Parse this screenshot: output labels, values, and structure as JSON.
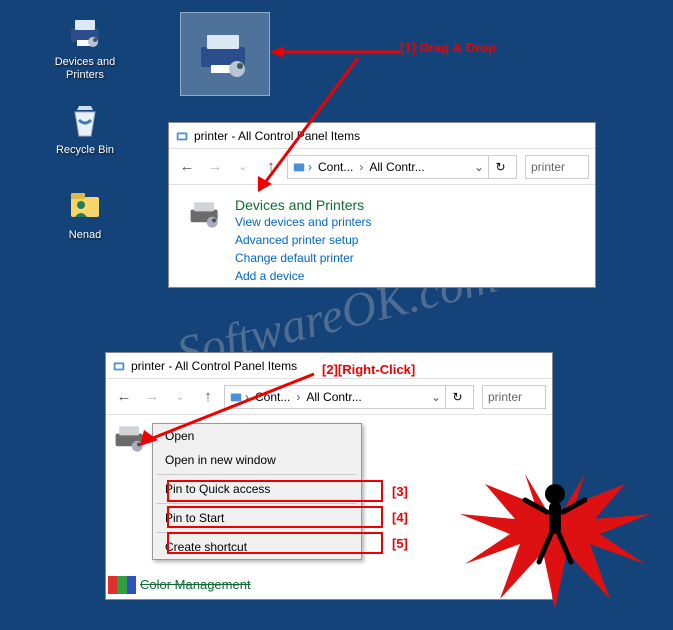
{
  "desktop": {
    "icons": [
      {
        "label": "Devices and\nPrinters",
        "name": "devices-printers-icon"
      },
      {
        "label": "Recycle Bin",
        "name": "recycle-bin-icon"
      },
      {
        "label": "Nenad",
        "name": "user-folder-icon"
      }
    ]
  },
  "annotations": {
    "a1": "[1]  Drag & Drop",
    "a2": "[2][Right-Click]",
    "a3": "[3]",
    "a4": "[4]",
    "a5": "[5]"
  },
  "window1": {
    "title": "printer - All Control Panel Items",
    "addr": {
      "seg1": "Cont...",
      "seg2": "All Contr..."
    },
    "search": "printer",
    "result": {
      "title": "Devices and Printers",
      "links": [
        "View devices and printers",
        "Advanced printer setup",
        "Change default printer",
        "Add a device"
      ]
    }
  },
  "window2": {
    "title": "printer - All Control Panel Items",
    "addr": {
      "seg1": "Cont...",
      "seg2": "All Contr..."
    },
    "search": "printer",
    "body_item": "Color Management"
  },
  "context_menu": {
    "items": [
      "Open",
      "Open in new window",
      "Pin to Quick access",
      "Pin to Start",
      "Create shortcut"
    ]
  },
  "watermark": "SoftwareOK.com"
}
